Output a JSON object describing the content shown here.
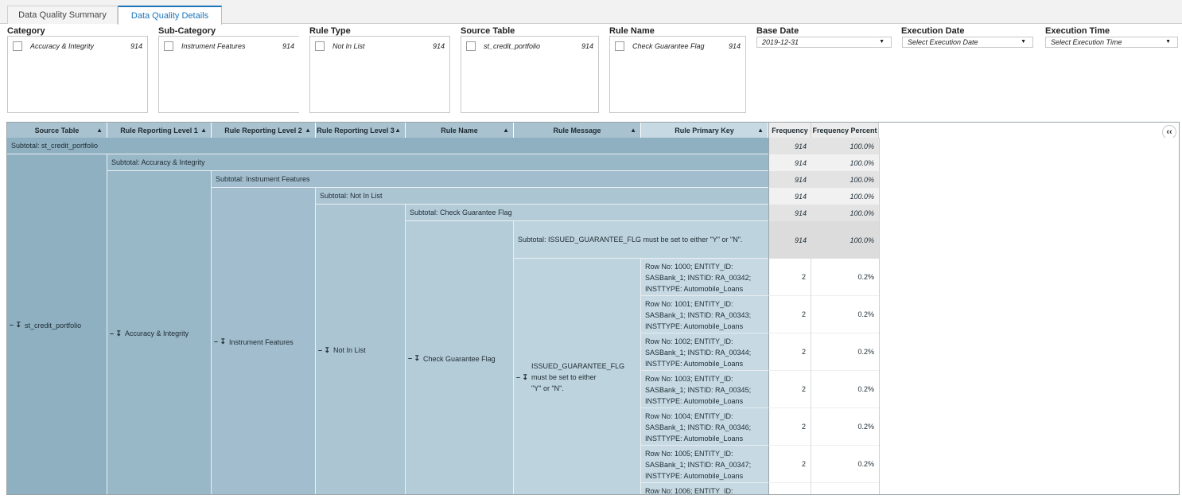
{
  "tabs": [
    {
      "label": "Data Quality Summary",
      "active": false
    },
    {
      "label": "Data Quality Details",
      "active": true
    }
  ],
  "filters": {
    "category": {
      "label": "Category",
      "item": "Accuracy & Integrity",
      "count": "914"
    },
    "subcategory": {
      "label": "Sub-Category",
      "item": "Instrument Features",
      "count": "914"
    },
    "rule_type": {
      "label": "Rule Type",
      "item": "Not In List",
      "count": "914"
    },
    "source_table": {
      "label": "Source Table",
      "item": "st_credit_portfolio",
      "count": "914"
    },
    "rule_name": {
      "label": "Rule Name",
      "item": "Check Guarantee Flag",
      "count": "914"
    },
    "base_date": {
      "label": "Base Date",
      "value": "2019-12-31"
    },
    "execution_date": {
      "label": "Execution Date",
      "placeholder": "Select Execution Date"
    },
    "execution_time": {
      "label": "Execution Time",
      "placeholder": "Select Execution Time"
    }
  },
  "table": {
    "headers": [
      "Source Table",
      "Rule Reporting Level 1",
      "Rule Reporting Level 2",
      "Rule Reporting Level 3",
      "Rule Name",
      "Rule Message",
      "Rule Primary Key",
      "Frequency",
      "Frequency Percent"
    ],
    "subtotals": [
      {
        "label": "Subtotal: st_credit_portfolio",
        "frequency": "914",
        "percent": "100.0%"
      },
      {
        "label": "Subtotal: Accuracy & Integrity",
        "frequency": "914",
        "percent": "100.0%"
      },
      {
        "label": "Subtotal: Instrument Features",
        "frequency": "914",
        "percent": "100.0%"
      },
      {
        "label": "Subtotal: Not In List",
        "frequency": "914",
        "percent": "100.0%"
      },
      {
        "label": "Subtotal: Check Guarantee Flag",
        "frequency": "914",
        "percent": "100.0%"
      },
      {
        "label": "Subtotal: ISSUED_GUARANTEE_FLG must be set to either \"Y\" or \"N\".",
        "frequency": "914",
        "percent": "100.0%"
      }
    ],
    "groups": {
      "source_table": "st_credit_portfolio",
      "level1": "Accuracy & Integrity",
      "level2": "Instrument Features",
      "level3": "Not In List",
      "rule_name": "Check Guarantee Flag",
      "rule_message": "ISSUED_GUARANTEE_FLG must be set to either \"Y\" or \"N\"."
    },
    "rows": [
      {
        "key": "Row No: 1000; ENTITY_ID: SASBank_1; INSTID: RA_00342; INSTTYPE: Automobile_Loans",
        "frequency": "2",
        "percent": "0.2%"
      },
      {
        "key": "Row No: 1001; ENTITY_ID: SASBank_1; INSTID: RA_00343; INSTTYPE: Automobile_Loans",
        "frequency": "2",
        "percent": "0.2%"
      },
      {
        "key": "Row No: 1002; ENTITY_ID: SASBank_1; INSTID: RA_00344; INSTTYPE: Automobile_Loans",
        "frequency": "2",
        "percent": "0.2%"
      },
      {
        "key": "Row No: 1003; ENTITY_ID: SASBank_1; INSTID: RA_00345; INSTTYPE: Automobile_Loans",
        "frequency": "2",
        "percent": "0.2%"
      },
      {
        "key": "Row No: 1004; ENTITY_ID: SASBank_1; INSTID: RA_00346; INSTTYPE: Automobile_Loans",
        "frequency": "2",
        "percent": "0.2%"
      },
      {
        "key": "Row No: 1005; ENTITY_ID: SASBank_1; INSTID: RA_00347; INSTTYPE: Automobile_Loans",
        "frequency": "2",
        "percent": "0.2%"
      },
      {
        "key": "Row No: 1006; ENTITY_ID:",
        "frequency": "",
        "percent": ""
      }
    ],
    "sort_glyph": "▲",
    "expand_glyph": "– ↧",
    "collapse_glyph": "‹‹",
    "colors": {
      "header": "#a9c2cf",
      "col1": "#8fb0c1",
      "col2": "#98b7c7",
      "col3": "#a2bece",
      "col4": "#abc5d3",
      "col5": "#b4ccd8",
      "col6": "#bdd3de",
      "col7": "#c7dae3",
      "freq_sub": "#d9d9d9"
    }
  }
}
